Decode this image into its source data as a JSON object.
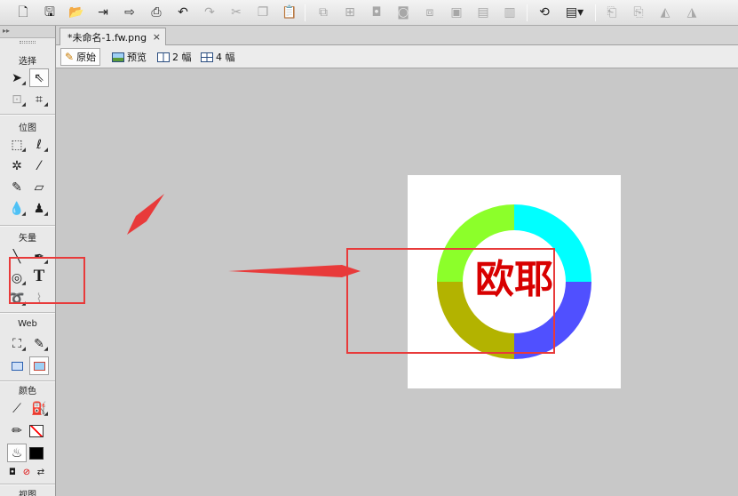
{
  "document": {
    "tab_label": "*未命名-1.fw.png",
    "close_label": "×"
  },
  "view_modes": [
    {
      "label": "原始",
      "icon": "pencil-icon",
      "selected": true
    },
    {
      "label": "预览",
      "icon": "preview-icon",
      "selected": false
    },
    {
      "label": "2 幅",
      "icon": "two-up-icon",
      "selected": false
    },
    {
      "label": "4 幅",
      "icon": "four-up-icon",
      "selected": false
    }
  ],
  "tools_panel": {
    "sections": {
      "select": "选择",
      "bitmap": "位图",
      "vector": "矢量",
      "web": "Web",
      "colors": "颜色",
      "view": "视图"
    }
  },
  "canvas": {
    "text": "欧耶",
    "text_color": "#d80000",
    "background": "#ffffff",
    "ring_segments": [
      {
        "color": "#00ffff",
        "share": 0.25
      },
      {
        "color": "#5050ff",
        "share": 0.25
      },
      {
        "color": "#b3b300",
        "share": 0.25
      },
      {
        "color": "#8cff2a",
        "share": 0.25
      }
    ]
  },
  "annotations": {
    "color": "#e83a3a"
  },
  "colors": {
    "stroke_swatch": "#ff0000",
    "fill_swatch": "#000000"
  }
}
